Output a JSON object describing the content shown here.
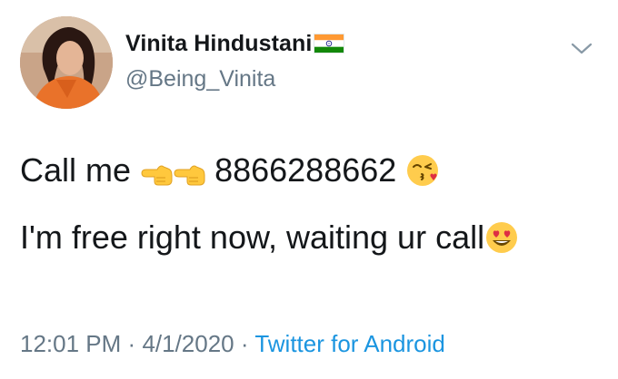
{
  "user": {
    "display_name": "Vinita Hindustani",
    "handle": "@Being_Vinita",
    "flag_icon": "india-flag-icon",
    "avatar": "profile-photo"
  },
  "tweet": {
    "line1_prefix": "Call me",
    "line1_icons": [
      "backhand-index-pointing-left-icon",
      "backhand-index-pointing-left-icon"
    ],
    "phone": "8866288662",
    "line1_emoji": "face-blowing-a-kiss-icon",
    "line2_text": "I'm free right now, waiting ur call",
    "line2_emoji": "smiling-face-with-heart-eyes-icon"
  },
  "meta": {
    "time": "12:01 PM",
    "separator": "·",
    "date": "4/1/2020",
    "source": "Twitter for Android"
  },
  "colors": {
    "text": "#14171a",
    "secondary": "#657786",
    "link": "#1b95e0"
  }
}
